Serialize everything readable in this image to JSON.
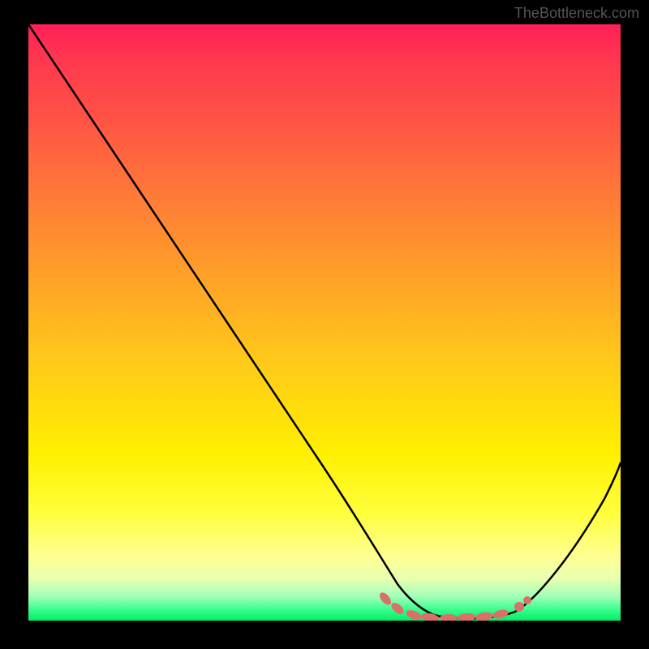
{
  "watermark": "TheBottleneck.com",
  "chart_data": {
    "type": "line",
    "title": "",
    "xlabel": "",
    "ylabel": "",
    "xlim": [
      0,
      100
    ],
    "ylim": [
      0,
      100
    ],
    "series": [
      {
        "name": "bottleneck-curve",
        "x": [
          0,
          5,
          10,
          15,
          20,
          25,
          30,
          35,
          40,
          45,
          50,
          55,
          60,
          62,
          65,
          68,
          72,
          76,
          80,
          82,
          85,
          88,
          92,
          96,
          100
        ],
        "values": [
          100,
          94,
          87,
          80,
          73,
          66,
          59,
          52,
          45,
          38,
          31,
          24,
          17,
          14,
          10,
          6,
          3,
          1,
          0,
          0,
          2,
          5,
          10,
          17,
          25
        ]
      }
    ],
    "markers": {
      "name": "optimal-range-markers",
      "x": [
        60,
        64,
        66,
        68,
        70,
        72,
        74,
        76,
        78,
        80,
        82,
        84
      ],
      "values": [
        15,
        9,
        7,
        5,
        3,
        2,
        1,
        1,
        0,
        0,
        1,
        2
      ],
      "color": "#d9716b"
    },
    "gradient": {
      "stops": [
        {
          "offset": 0,
          "color": "#ff1f56"
        },
        {
          "offset": 50,
          "color": "#ffc81a"
        },
        {
          "offset": 85,
          "color": "#ffff60"
        },
        {
          "offset": 100,
          "color": "#00ee66"
        }
      ]
    }
  }
}
